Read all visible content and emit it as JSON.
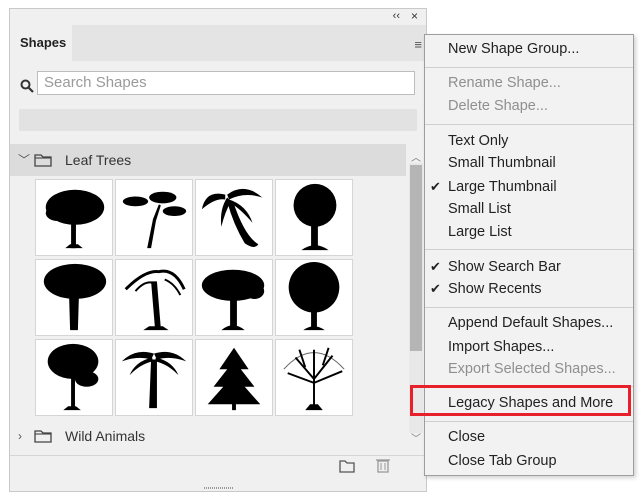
{
  "panel": {
    "tab_label": "Shapes",
    "search_placeholder": "Search Shapes",
    "groups": [
      {
        "label": "Leaf Trees",
        "expanded": true
      },
      {
        "label": "Wild Animals",
        "expanded": false
      }
    ],
    "collapse_icon": "double-chevron-left-icon",
    "menu_icon": "hamburger-icon"
  },
  "menu": {
    "new_shape_group": "New Shape Group...",
    "rename_shape": "Rename Shape...",
    "delete_shape": "Delete Shape...",
    "text_only": "Text Only",
    "small_thumbnail": "Small Thumbnail",
    "large_thumbnail": "Large Thumbnail",
    "small_list": "Small List",
    "large_list": "Large List",
    "show_search_bar": "Show Search Bar",
    "show_recents": "Show Recents",
    "append_default_shapes": "Append Default Shapes...",
    "import_shapes": "Import Shapes...",
    "export_selected_shapes": "Export Selected Shapes...",
    "legacy_shapes": "Legacy Shapes and More",
    "close": "Close",
    "close_tab_group": "Close Tab Group"
  },
  "colors": {
    "highlight_border": "#e8202a",
    "panel_bg": "#f0f0f0",
    "menu_bg": "#f2f2f2"
  }
}
